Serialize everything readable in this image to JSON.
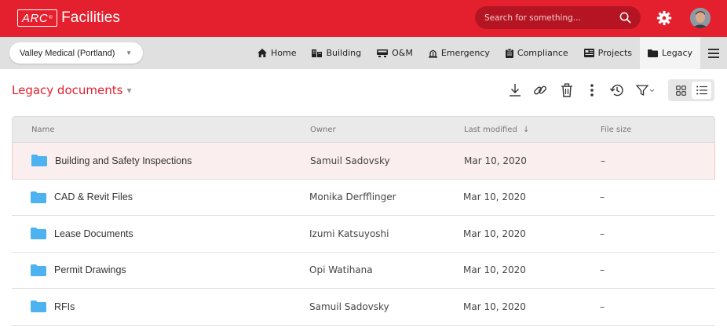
{
  "app": {
    "logo_mark": "ARC",
    "logo_text": "Facilities"
  },
  "search": {
    "placeholder": "Search for something...",
    "icon": "search-icon"
  },
  "site_selector": {
    "value": "Valley Medical (Portland)"
  },
  "nav": {
    "items": [
      {
        "label": "Home",
        "icon": "home-icon",
        "glyph": "🏠"
      },
      {
        "label": "Building",
        "icon": "building-icon",
        "glyph": "▥"
      },
      {
        "label": "O&M",
        "icon": "om-icon",
        "glyph": "▭"
      },
      {
        "label": "Emergency",
        "icon": "emergency-icon",
        "glyph": "⚠"
      },
      {
        "label": "Compliance",
        "icon": "clipboard-icon",
        "glyph": "▤"
      },
      {
        "label": "Projects",
        "icon": "projects-icon",
        "glyph": "▦"
      },
      {
        "label": "Legacy",
        "icon": "folder-icon",
        "glyph": "▬"
      }
    ],
    "active": "Legacy"
  },
  "page": {
    "title": "Legacy documents"
  },
  "table": {
    "columns": {
      "name": "Name",
      "owner": "Owner",
      "modified": "Last modified",
      "sort_indicator": "↓",
      "size": "File size"
    },
    "rows": [
      {
        "name": "Building and Safety Inspections",
        "owner": "Samuil Sadovsky",
        "modified": "Mar 10, 2020",
        "size": "–"
      },
      {
        "name": "CAD & Revit Files",
        "owner": "Monika Derfflinger",
        "modified": "Mar 10, 2020",
        "size": "–"
      },
      {
        "name": "Lease Documents",
        "owner": "Izumi Katsuyoshi",
        "modified": "Mar 10, 2020",
        "size": "–"
      },
      {
        "name": "Permit Drawings",
        "owner": "Opi Watihana",
        "modified": "Mar 10, 2020",
        "size": "–"
      },
      {
        "name": "RFIs",
        "owner": "Samuil Sadovsky",
        "modified": "Mar 10, 2020",
        "size": "–"
      }
    ]
  },
  "colors": {
    "brand": "#e4202e",
    "selected_row": "#fbeeee",
    "folder": "#4db3f0"
  }
}
